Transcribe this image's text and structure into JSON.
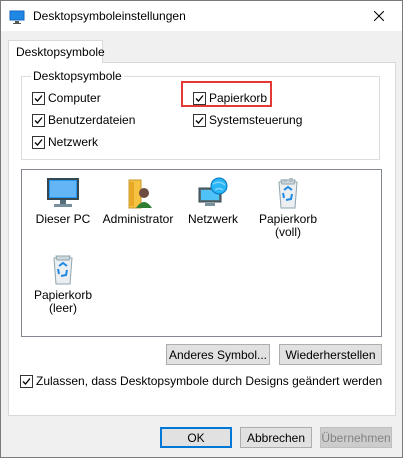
{
  "window": {
    "title": "Desktopsymboleinstellungen",
    "close_icon": "close-icon"
  },
  "tab": {
    "label": "Desktopsymbole"
  },
  "group": {
    "legend": "Desktopsymbole",
    "checkboxes": [
      {
        "label": "Computer",
        "checked": true
      },
      {
        "label": "Papierkorb",
        "checked": true,
        "highlighted": true
      },
      {
        "label": "Benutzerdateien",
        "checked": true
      },
      {
        "label": "Systemsteuerung",
        "checked": true
      },
      {
        "label": "Netzwerk",
        "checked": true
      }
    ]
  },
  "icons": [
    {
      "label": "Dieser PC",
      "icon": "computer-icon"
    },
    {
      "label": "Administrator",
      "icon": "user-folder-icon"
    },
    {
      "label": "Netzwerk",
      "icon": "network-icon"
    },
    {
      "label_line1": "Papierkorb",
      "label_line2": "(voll)",
      "icon": "recycle-bin-full-icon"
    },
    {
      "label_line1": "Papierkorb",
      "label_line2": "(leer)",
      "icon": "recycle-bin-empty-icon"
    }
  ],
  "buttons": {
    "change_icon": "Anderes Symbol...",
    "restore": "Wiederherstellen",
    "ok": "OK",
    "cancel": "Abbrechen",
    "apply": "Übernehmen"
  },
  "themes_checkbox": {
    "label": "Zulassen, dass Desktopsymbole durch Designs geändert werden",
    "checked": true
  },
  "colors": {
    "highlight_border": "#e53935",
    "default_button_border": "#0078d7"
  }
}
